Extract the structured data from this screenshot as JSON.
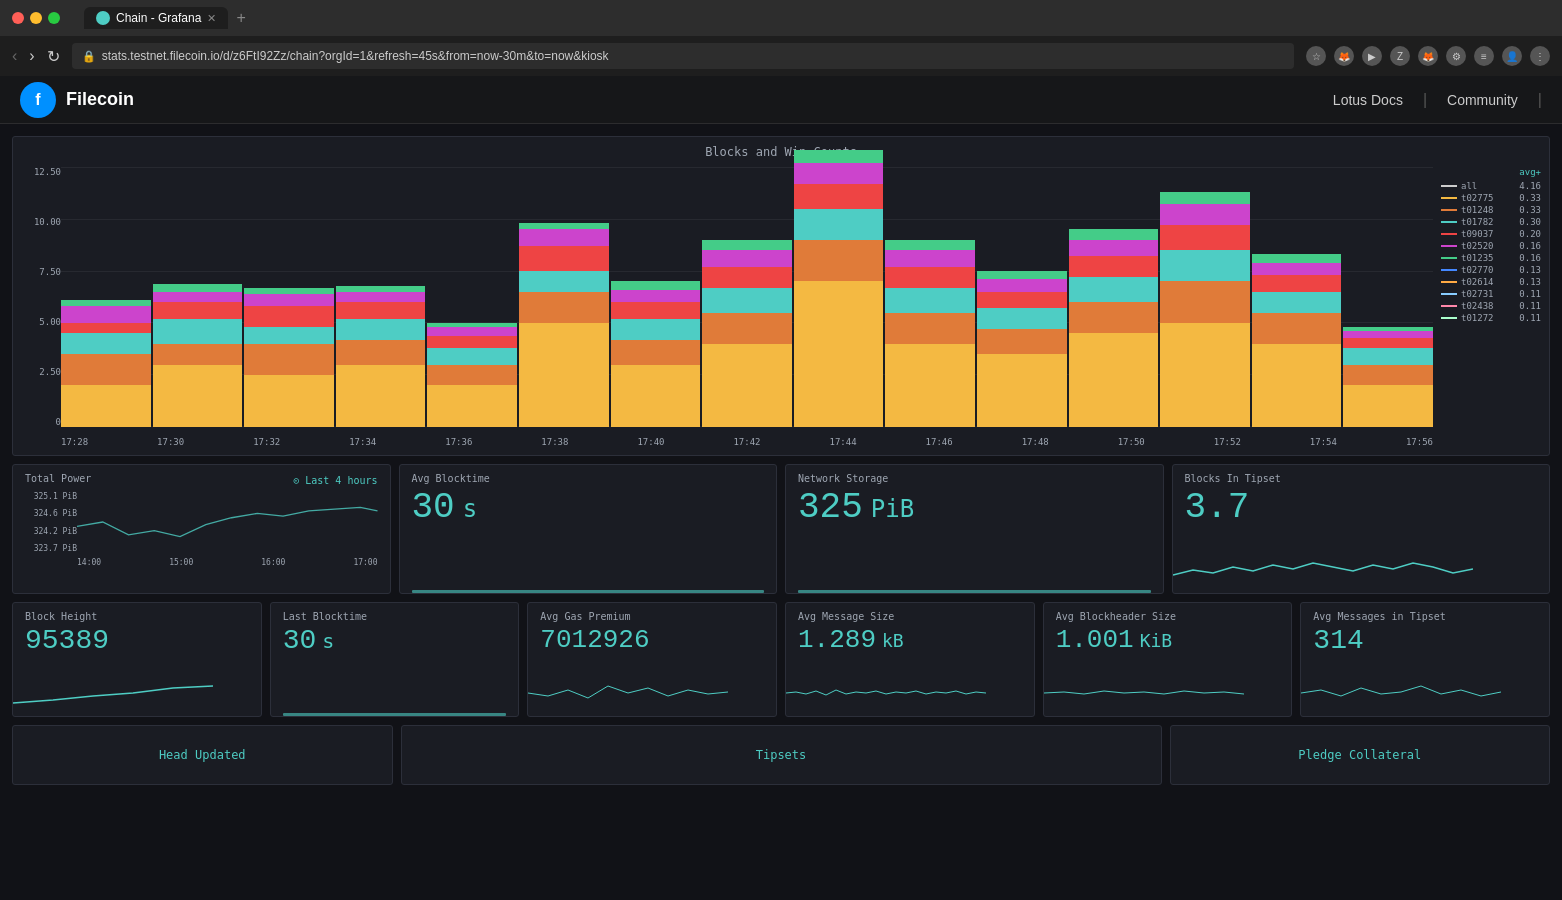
{
  "window": {
    "tab_title": "Chain - Grafana",
    "url": "stats.testnet.filecoin.io/d/z6FtI92Zz/chain?orgId=1&refresh=45s&from=now-30m&to=now&kiosk"
  },
  "header": {
    "logo_letter": "f",
    "app_name": "Filecoin",
    "nav": [
      {
        "label": "Lotus Docs"
      },
      {
        "label": "Community"
      }
    ]
  },
  "big_chart": {
    "title": "Blocks and Win Counts",
    "y_labels": [
      "12.50",
      "10.00",
      "7.50",
      "5.00",
      "2.50",
      "0"
    ],
    "x_labels": [
      "17:28",
      "17:30",
      "17:32",
      "17:34",
      "17:36",
      "17:38",
      "17:40",
      "17:42",
      "17:44",
      "17:46",
      "17:48",
      "17:50",
      "17:52",
      "17:54",
      "17:56"
    ],
    "legend": {
      "header_left": "",
      "header_right": "avg+",
      "items": [
        {
          "name": "all",
          "color": "#cccccc",
          "value": "4.16"
        },
        {
          "name": "t02775",
          "color": "#f4b942",
          "value": "0.33"
        },
        {
          "name": "t01248",
          "color": "#e07b39",
          "value": "0.33"
        },
        {
          "name": "t01782",
          "color": "#4ecdc4",
          "value": "0.30"
        },
        {
          "name": "t09037",
          "color": "#ee4444",
          "value": "0.20"
        },
        {
          "name": "t02520",
          "color": "#cc44cc",
          "value": "0.16"
        },
        {
          "name": "t01235",
          "color": "#44cc88",
          "value": "0.16"
        },
        {
          "name": "t02770",
          "color": "#4488ff",
          "value": "0.13"
        },
        {
          "name": "t02614",
          "color": "#ffaa44",
          "value": "0.13"
        },
        {
          "name": "t02731",
          "color": "#88ccff",
          "value": "0.11"
        },
        {
          "name": "t02438",
          "color": "#ff88aa",
          "value": "0.11"
        },
        {
          "name": "t01272",
          "color": "#aaffcc",
          "value": "0.11"
        }
      ]
    }
  },
  "total_power": {
    "title": "Total Power",
    "last_n": "Last 4 hours",
    "y_labels": [
      "325.1 PiB",
      "324.6 PiB",
      "324.2 PiB",
      "323.7 PiB"
    ],
    "x_labels": [
      "14:00",
      "15:00",
      "16:00",
      "17:00"
    ]
  },
  "avg_blocktime": {
    "title": "Avg Blocktime",
    "value": "30",
    "unit": "s"
  },
  "network_storage": {
    "title": "Network Storage",
    "value": "325",
    "unit": "PiB"
  },
  "blocks_in_tipset": {
    "title": "Blocks In Tipset",
    "value": "3.7"
  },
  "block_height": {
    "title": "Block Height",
    "value": "95389"
  },
  "last_blocktime": {
    "title": "Last Blocktime",
    "value": "30",
    "unit": "s"
  },
  "avg_gas_premium": {
    "title": "Avg Gas Premium",
    "value": "7012926"
  },
  "avg_message_size": {
    "title": "Avg Message Size",
    "value": "1.289",
    "unit": "kB"
  },
  "avg_blockheader_size": {
    "title": "Avg Blockheader Size",
    "value": "1.001",
    "unit": "KiB"
  },
  "avg_messages_tipset": {
    "title": "Avg Messages in Tipset",
    "value": "314"
  },
  "bottom": {
    "head_updated": "Head Updated",
    "tipsets": "Tipsets",
    "pledge_collateral": "Pledge Collateral"
  },
  "colors": {
    "accent": "#4ecdc4",
    "bg_card": "#1a1c23",
    "bg_main": "#111217",
    "text_muted": "#9fa7b3"
  }
}
